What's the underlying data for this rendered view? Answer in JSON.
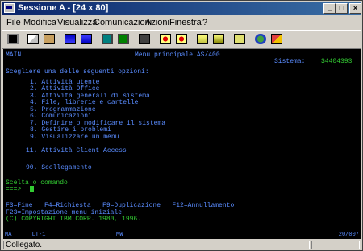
{
  "window": {
    "title": "Sessione A - [24 x 80]"
  },
  "window_buttons": {
    "minimize": "_",
    "maximize": "□",
    "close": "×"
  },
  "menu": [
    "File",
    "Modifica",
    "Visualizza",
    "Comunicazioni",
    "Azioni",
    "Finestra",
    "?"
  ],
  "toolbar_icons": [
    "print-screen-icon",
    "copy-icon",
    "paste-icon",
    "send-icon",
    "receive-icon",
    "display-icon",
    "color-map-icon",
    "keyboard-map-icon",
    "macro-record-icon",
    "macro-stop-icon",
    "macro-play-icon",
    "macro-run-icon",
    "clipboard-icon",
    "internet-icon",
    "help-icon"
  ],
  "terminal": {
    "screen_id": "MAIN",
    "screen_title": "Menu principale AS/400",
    "system_label": "Sistema:",
    "system_name": "S4404393",
    "instruction": "Scegliere una delle seguenti opzioni:",
    "options": [
      "1. Attività utente",
      "2. Attività Office",
      "3. Attività generali di sistema",
      "4. File, librerie e cartelle",
      "5. Programmazione",
      "6. Comunicazioni",
      "7. Definire o modificare il sistema",
      "8. Gestire i problemi",
      "9. Visualizzare un menu"
    ],
    "option_11": "11. Attività Client Access",
    "option_90": "90. Scollegamento",
    "prompt_label": "Scelta o comando",
    "prompt_arrow": "===>",
    "fkeys_line1": "F3=Fine   F4=Richiesta   F9=Duplicazione   F12=Annullamento",
    "fkeys_line2": "F23=Impostazione menu iniziale",
    "copyright": "(C) COPYRIGHT IBM CORP. 1980, 1996."
  },
  "oia": {
    "left": "MA      LT-1",
    "middle": "MW",
    "position": "20/007"
  },
  "statusbar": {
    "text": "Collegato."
  },
  "colors": {
    "terminal_text": "#33cc33",
    "terminal_info": "#5a8cff",
    "titlebar": "#0a246a"
  }
}
